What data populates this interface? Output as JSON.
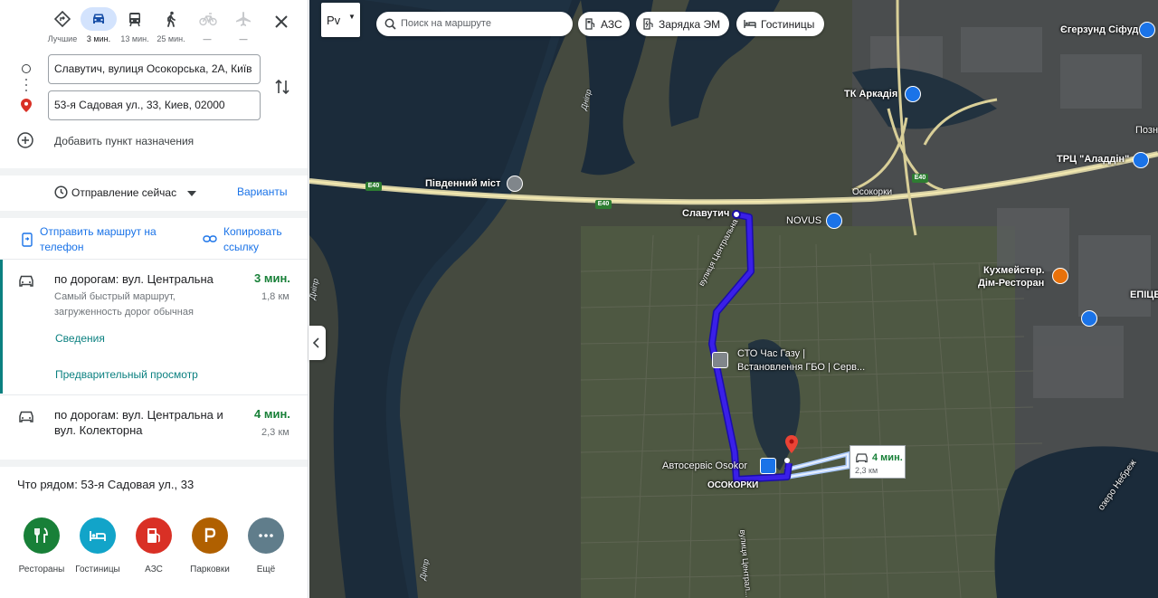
{
  "travel_modes": [
    {
      "label": "Лучшие",
      "icon": "directions-diamond-icon"
    },
    {
      "label": "3 мин.",
      "icon": "car-icon",
      "active": true
    },
    {
      "label": "13 мин.",
      "icon": "transit-icon"
    },
    {
      "label": "25 мин.",
      "icon": "walk-icon"
    },
    {
      "label": "—",
      "icon": "bicycle-icon"
    },
    {
      "label": "—",
      "icon": "plane-icon"
    }
  ],
  "origin": {
    "value": "Славутич, вулиця Осокорська, 2А, Київ"
  },
  "destination": {
    "value": "53-я Садовая ул., 33, Киев, 02000"
  },
  "add_destination": "Добавить пункт назначения",
  "departure": {
    "label": "Отправление сейчас",
    "options_link": "Варианты"
  },
  "actions": {
    "send_to_phone_line1": "Отправить маршрут на",
    "send_to_phone_line2": "телефон",
    "copy_link_line1": "Копировать",
    "copy_link_line2": "ссылку"
  },
  "routes": [
    {
      "title": "по дорогам: вул. Центральна",
      "time": "3 мин.",
      "distance": "1,8 км",
      "desc_line1": "Самый быстрый маршрут,",
      "desc_line2": "загруженность дорог обычная",
      "details_link": "Сведения",
      "preview_link": "Предварительный просмотр"
    },
    {
      "title_line1": "по дорогам: вул. Центральна и",
      "title_line2": "вул. Колекторна",
      "time": "4 мин.",
      "distance": "2,3 км"
    }
  ],
  "nearby": {
    "title": "Что рядом: 53-я Садовая ул., 33",
    "items": [
      {
        "label": "Рестораны",
        "color": "#188038",
        "icon": "restaurant-icon"
      },
      {
        "label": "Гостиницы",
        "color": "#12a4c9",
        "icon": "hotel-icon"
      },
      {
        "label": "АЗС",
        "color": "#d93025",
        "icon": "gas-station-icon"
      },
      {
        "label": "Парковки",
        "color": "#b06000",
        "icon": "parking-icon"
      },
      {
        "label": "Ещё",
        "color": "#607d8b",
        "icon": "more-icon"
      }
    ]
  },
  "map": {
    "layer_button": "Рv",
    "search_placeholder": "Поиск на маршруте",
    "chips": [
      "АЗС",
      "Зарядка ЭМ",
      "Гостиницы"
    ],
    "labels": {
      "south_bridge": "Південний міст",
      "slavutych": "Славутич",
      "novus": "NOVUS",
      "osokorky_top": "Осокорки",
      "arkadia": "ТК Аркадія",
      "aladdin": "ТРЦ \"Аладдін\"",
      "sifud": "Єгерзунд Сіфуд",
      "pozn": "Позн",
      "kuhmeister_1": "Кухмейстер.",
      "kuhmeister_2": "Дім-Ресторан",
      "epicenter": "ЕПІЦЕНТ",
      "sto_1": "СТО Час Газу |",
      "sto_2": "Встановлення ГБО | Серв...",
      "autoservice": "Автосервіс Osokor",
      "osokorky_bottom": "ОСОКОРКИ",
      "centralna_street": "вулиця Центральна",
      "centralna_street_bottom": "вулиця Централ...",
      "lake": "озеро Небреж",
      "dnipro": "Дніпр",
      "dnipro_2": "Дніпр",
      "dnipro_3": "Дніпр",
      "e40": "E40"
    },
    "eta_box": {
      "time": "4 мин.",
      "distance": "2,3 км"
    },
    "colors": {
      "route": "#3a1fe8",
      "route_alt": "#a8c7fa",
      "water": "#1b2b3a"
    }
  }
}
